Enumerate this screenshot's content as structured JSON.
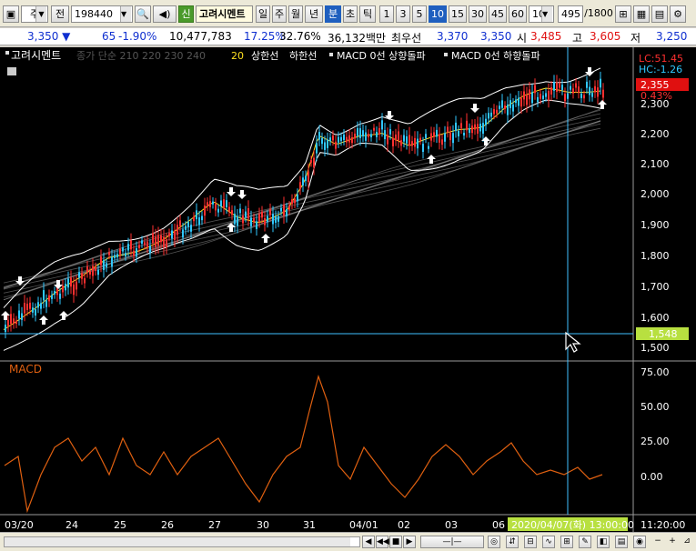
{
  "toolbar": {
    "market": "주",
    "jeon": "전",
    "code": "198440",
    "credit_badge": "신",
    "stock_name": "고려시멘트",
    "periods": [
      "일",
      "주",
      "월",
      "년",
      "분",
      "초",
      "틱"
    ],
    "active_period": "분",
    "intervals": [
      "1",
      "3",
      "5",
      "10",
      "15",
      "30",
      "45",
      "60"
    ],
    "active_interval": "10",
    "interval_select": "10",
    "count": "495",
    "count_total": "/1800"
  },
  "info": {
    "price": "3,350",
    "change": "65",
    "change_pct": "-1.90%",
    "volume": "10,477,783",
    "turnover_pct": "17.25%",
    "ratio_pct": "32.76%",
    "amount": "36,132백만",
    "best_label": "최우선",
    "best_ask": "3,370",
    "best_bid": "3,350",
    "open_label": "시",
    "open": "3,485",
    "high_label": "고",
    "high": "3,605",
    "low_label": "저",
    "low": "3,250"
  },
  "legend": {
    "name": "고려시멘트",
    "ma_group": "종가 단순 210  220  230  240",
    "ma20": "20",
    "upper": "상한선",
    "lower": "하한선",
    "macd_up": "MACD 0선 상향돌파",
    "macd_down": "MACD 0선 하향돌파"
  },
  "price_axis": {
    "ticks": [
      "2,300",
      "2,200",
      "2,100",
      "2,000",
      "1,900",
      "1,800",
      "1,700",
      "1,600",
      "1,500"
    ],
    "lc": "LC:51.45",
    "hc": "HC:-1.26",
    "current": "2,355",
    "current_pct": "0.43%",
    "cursor_value": "1,548"
  },
  "macd": {
    "title": "MACD",
    "ticks": [
      "75.00",
      "50.00",
      "25.00",
      "0.00"
    ]
  },
  "time_axis": {
    "labels": [
      "03/20",
      "24",
      "25",
      "26",
      "27",
      "30",
      "31",
      "04/01",
      "02",
      "03",
      "06"
    ],
    "cursor_label": "2020/04/07(화) 13:00:00",
    "right_label": "11:20:00"
  },
  "colors": {
    "up": "#ff3030",
    "down": "#30c8ff",
    "ma20": "#ffe020",
    "macd": "#e06010",
    "cursor": "#40c0ff",
    "active": "#1f5fbf",
    "green": "#4a9a2a"
  }
}
